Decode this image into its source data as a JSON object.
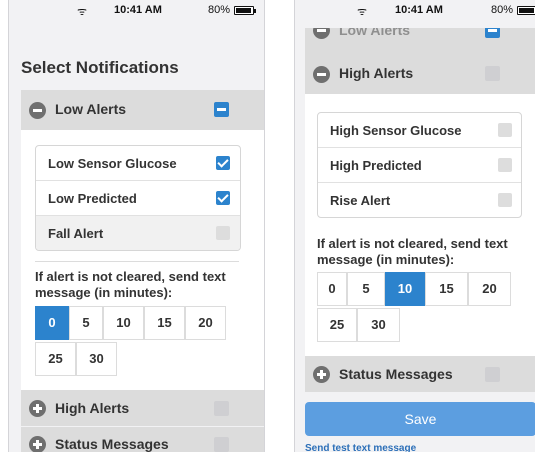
{
  "status_bar": {
    "time": "10:41 AM",
    "battery": "80%",
    "battery_level": 0.8
  },
  "screen1": {
    "title": "Select Notifications",
    "low_alerts": {
      "label": "Low Alerts",
      "items": [
        {
          "label": "Low Sensor Glucose",
          "checked": true,
          "enabled": true
        },
        {
          "label": "Low Predicted",
          "checked": true,
          "enabled": true
        },
        {
          "label": "Fall Alert",
          "checked": false,
          "enabled": false
        }
      ]
    },
    "note": "If alert is not cleared, send text message (in minutes):",
    "minutes": [
      "0",
      "5",
      "10",
      "15",
      "20",
      "25",
      "30"
    ],
    "selected_minutes": "0",
    "high_alerts": {
      "label": "High Alerts"
    },
    "status_messages": {
      "label": "Status Messages"
    }
  },
  "screen2": {
    "low_alerts": {
      "label": "Low Alerts"
    },
    "high_alerts": {
      "label": "High Alerts",
      "items": [
        {
          "label": "High Sensor Glucose",
          "checked": false,
          "enabled": true
        },
        {
          "label": "High Predicted",
          "checked": false,
          "enabled": true
        },
        {
          "label": "Rise Alert",
          "checked": false,
          "enabled": true
        }
      ]
    },
    "note": "If alert is not cleared, send text message (in minutes):",
    "minutes": [
      "0",
      "5",
      "10",
      "15",
      "20",
      "25",
      "30"
    ],
    "selected_minutes": "10",
    "status_messages": {
      "label": "Status Messages"
    },
    "save_label": "Save",
    "test_link": "Send test text message"
  },
  "colors": {
    "accent": "#2c83cd",
    "save_button": "#5c9ee0",
    "header_bg": "#dcdcdc"
  }
}
